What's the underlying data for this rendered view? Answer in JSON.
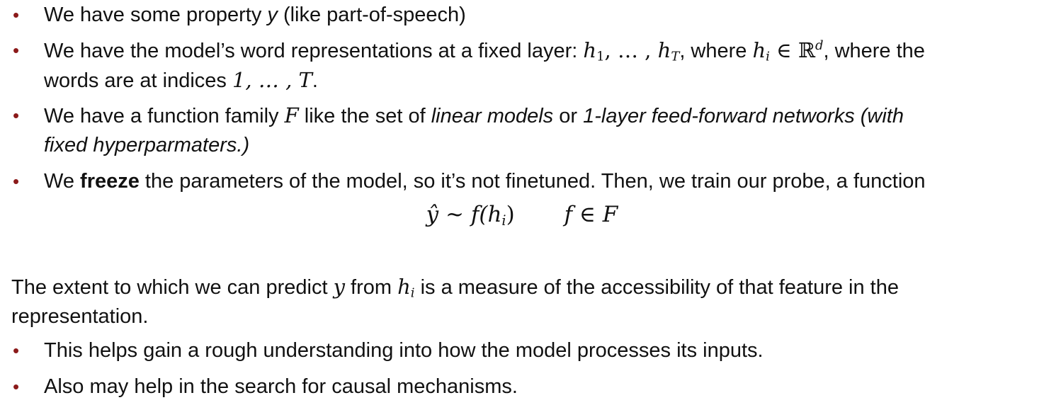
{
  "slide": {
    "bullets_top": [
      {
        "part1": "We have some property ",
        "math_y": "y",
        "part2": " (like part-of-speech)"
      },
      {
        "part1": "We have the model’s word representations at a fixed layer: ",
        "h": "h",
        "sub1": "1",
        "dots": ", … , ",
        "h2": "h",
        "subT": "T",
        "part2": ", where ",
        "h3": "h",
        "subi": "i",
        "in": " ∈ ",
        "R": "ℝ",
        "supd": "d",
        "part3": ", where the",
        "line2_part1": "words are at indices ",
        "line2_math": "1, … , T",
        "line2_part2": "."
      },
      {
        "part1": "We have a function family ",
        "math_F": "F",
        "part2": " like the set of ",
        "ital1": "linear models",
        "part3": " or ",
        "ital2": "1-layer feed-forward networks (with",
        "line2_ital": "fixed hyperparmaters.)"
      },
      {
        "part1": "We ",
        "bold": "freeze",
        "part2": " the parameters of the model, so it’s not finetuned. Then, we train our probe, a function"
      }
    ],
    "equation": {
      "lhs": "ŷ ~ f(",
      "h": "h",
      "sub": "i",
      "close": ")",
      "rhs": "f ∈ F"
    },
    "paragraph": {
      "part1": "The extent to which we can predict ",
      "math_y": "y",
      "part2": " from ",
      "h": "h",
      "sub": "i",
      "part3": " is a measure of the accessibility of that feature in the",
      "line2": "representation."
    },
    "bullets_bottom": [
      "This helps gain a rough understanding into how the model processes its inputs.",
      "Also may help in the search for causal mechanisms."
    ],
    "bullet_symbol": "•",
    "colors": {
      "bullet": "#8b1a1a",
      "text": "#111111",
      "background": "#ffffff"
    }
  }
}
